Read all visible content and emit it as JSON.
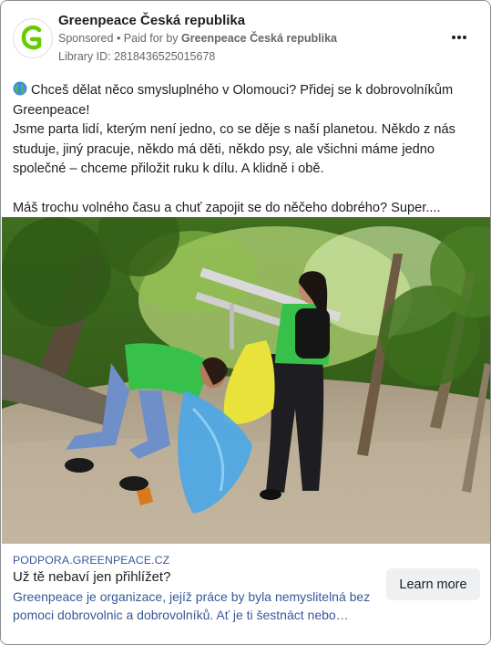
{
  "post": {
    "page_name": "Greenpeace Česká republika",
    "sponsored": "Sponsored",
    "paid_prefix": "• Paid for by",
    "paid_by": "Greenpeace Česká republika",
    "library_id": "Library ID: 2818436525015678",
    "avatar_logo": "G",
    "body": {
      "line1": "Chceš dělat něco smysluplného v Olomouci? Přidej se k dobrovolníkům Greenpeace!",
      "line2": "Jsme parta lidí, kterým není jedno, co se děje s naší planetou. Někdo z nás studuje, jiný pracuje, někdo má děti, někdo psy, ale všichni máme jedno společné – chceme přiložit ruku k dílu. A klidně i obě.",
      "line3": "Máš trochu volného času a chuť zapojit se do něčeho dobrého? Super...."
    }
  },
  "link_preview": {
    "domain": "PODPORA.GREENPEACE.CZ",
    "headline": "Už tě nebaví jen přihlížet?",
    "description": "Greenpeace je organizace, jejíž práce by byla nemyslitelná bez pomoci dobrovolnic a dobrovolníků. Ať je ti šestnáct nebo…",
    "cta_label": "Learn more"
  },
  "icons": {
    "more": "more-horizontal-icon",
    "globe": "globe-emoji-icon"
  },
  "colors": {
    "brand_green": "#66cc00",
    "link_blue": "#385898",
    "meta_gray": "#65676b"
  }
}
